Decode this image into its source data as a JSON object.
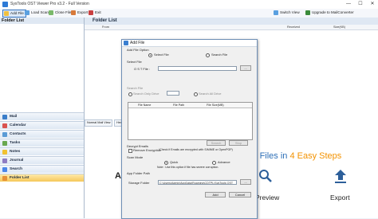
{
  "app": {
    "title": "SysTools OST Viewer Pro  v3.2 - Full Version",
    "min_glyph": "—",
    "max_glyph": "☐",
    "close_glyph": "✕"
  },
  "toolbar": {
    "add_file": "Add File",
    "load_scan": "Load Scan",
    "close_file": "Close File",
    "export": "Export",
    "exit": "Exit",
    "switch_view": "Switch View",
    "upgrade": "Upgrade to MailConverter"
  },
  "sidebar": {
    "title": "Folder List",
    "items": [
      "Mail",
      "Calendar",
      "Contacts",
      "Tasks",
      "Notes",
      "Journal",
      "Search",
      "Folder List"
    ]
  },
  "main": {
    "title": "Folder List",
    "columns": [
      "From",
      "Received",
      "Size(KB)"
    ],
    "tabs": [
      "Normal Mail View",
      "Hex"
    ]
  },
  "promo": {
    "title_prefix": "T Files in ",
    "title_accent": "4 Easy Steps",
    "step_add": "Add",
    "step_preview": "Preview",
    "step_export": "Export"
  },
  "dialog": {
    "title": "Add File",
    "add_file_option_label": "Add File Option",
    "select_file_radio": "Select File",
    "search_file_radio": "Search File",
    "select_file_label": "Select File",
    "ost_file_label": "O S T File :",
    "browse": "...",
    "search_file_label": "Search File",
    "search_drive_radio": "Search Only Drive",
    "search_all_radio": "Search All Drive",
    "grid_columns": [
      "File Name",
      "File Path",
      "File Size(MB)"
    ],
    "search_btn": "Search",
    "stop_btn": "Stop",
    "decrypt_label": "Decrypt Emails",
    "remove_encryption": "Remove Encryption",
    "decrypt_note": "(Check if Emails are encrypted with S/MIME or OpenPGP)",
    "scan_mode_label": "Scan Mode",
    "quick_radio": "Quick",
    "advance_radio": "Advance",
    "scan_note": "Note : Use this option if file has severe corruption.",
    "app_folder_label": "App Folder Path",
    "storage_folder_label": "Storage Folder",
    "storage_path": "C:\\Users\\Admin\\AppData\\Roaming\\CDTPL\\SysTools OST",
    "add_btn": "Add",
    "cancel_btn": "Cancel"
  }
}
